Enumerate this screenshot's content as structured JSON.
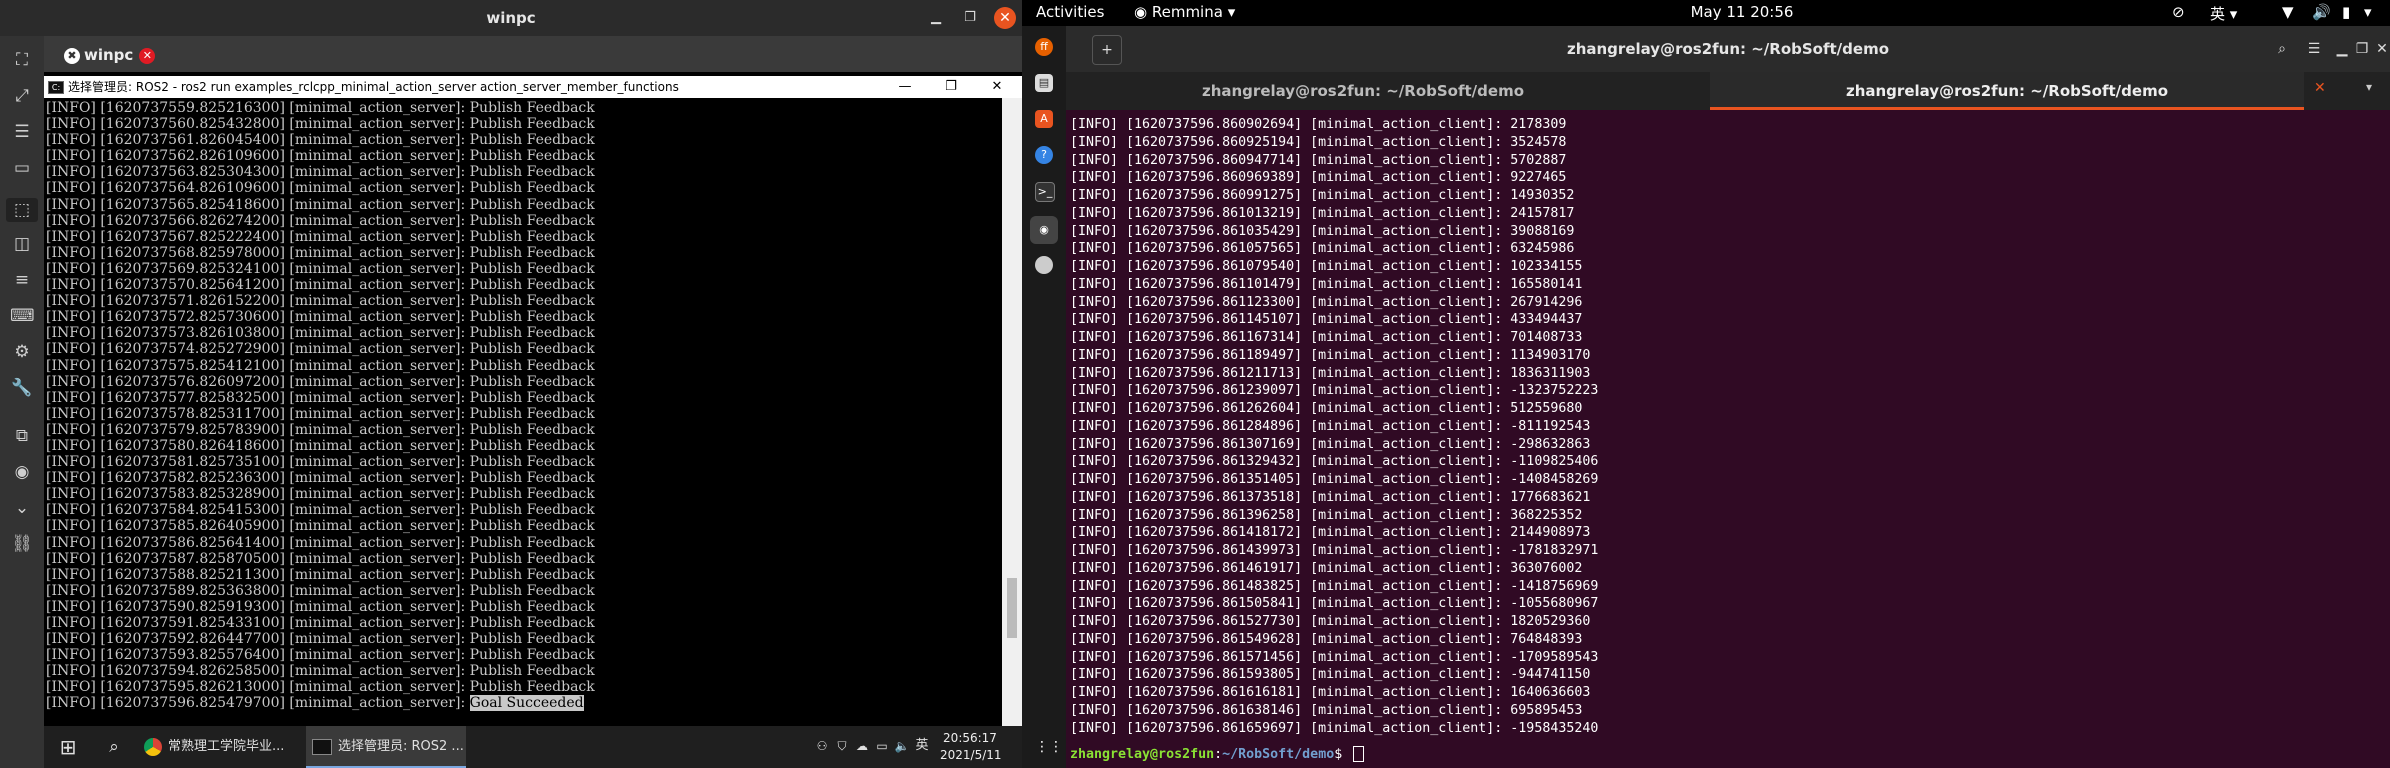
{
  "remmina": {
    "window_title": "winpc",
    "tab_label": "winpc",
    "sidebar_icons": [
      "fullscreen-icon",
      "scale-icon",
      "menu-icon",
      "window-icon",
      "selection-icon",
      "dynamic-resolution-icon",
      "list-icon",
      "keyboard-icon",
      "preferences-icon",
      "tools-icon",
      "duplicate-icon",
      "screenshot-icon",
      "chevron-down-icon",
      "disconnect-icon"
    ]
  },
  "cmd": {
    "title": "选择管理员: ROS2 - ros2  run examples_rclcpp_minimal_action_server action_server_member_functions",
    "lines": [
      "[INFO] [1620737559.825216300] [minimal_action_server]: Publish Feedback",
      "[INFO] [1620737560.825432800] [minimal_action_server]: Publish Feedback",
      "[INFO] [1620737561.826045400] [minimal_action_server]: Publish Feedback",
      "[INFO] [1620737562.826109600] [minimal_action_server]: Publish Feedback",
      "[INFO] [1620737563.825304300] [minimal_action_server]: Publish Feedback",
      "[INFO] [1620737564.826109600] [minimal_action_server]: Publish Feedback",
      "[INFO] [1620737565.825418600] [minimal_action_server]: Publish Feedback",
      "[INFO] [1620737566.826274200] [minimal_action_server]: Publish Feedback",
      "[INFO] [1620737567.825222400] [minimal_action_server]: Publish Feedback",
      "[INFO] [1620737568.825978000] [minimal_action_server]: Publish Feedback",
      "[INFO] [1620737569.825324100] [minimal_action_server]: Publish Feedback",
      "[INFO] [1620737570.825641200] [minimal_action_server]: Publish Feedback",
      "[INFO] [1620737571.826152200] [minimal_action_server]: Publish Feedback",
      "[INFO] [1620737572.825730600] [minimal_action_server]: Publish Feedback",
      "[INFO] [1620737573.826103800] [minimal_action_server]: Publish Feedback",
      "[INFO] [1620737574.825272900] [minimal_action_server]: Publish Feedback",
      "[INFO] [1620737575.825412100] [minimal_action_server]: Publish Feedback",
      "[INFO] [1620737576.826097200] [minimal_action_server]: Publish Feedback",
      "[INFO] [1620737577.825832500] [minimal_action_server]: Publish Feedback",
      "[INFO] [1620737578.825311700] [minimal_action_server]: Publish Feedback",
      "[INFO] [1620737579.825783900] [minimal_action_server]: Publish Feedback",
      "[INFO] [1620737580.826418600] [minimal_action_server]: Publish Feedback",
      "[INFO] [1620737581.825735100] [minimal_action_server]: Publish Feedback",
      "[INFO] [1620737582.825236300] [minimal_action_server]: Publish Feedback",
      "[INFO] [1620737583.825328900] [minimal_action_server]: Publish Feedback",
      "[INFO] [1620737584.825415300] [minimal_action_server]: Publish Feedback",
      "[INFO] [1620737585.826405900] [minimal_action_server]: Publish Feedback",
      "[INFO] [1620737586.825641400] [minimal_action_server]: Publish Feedback",
      "[INFO] [1620737587.825870500] [minimal_action_server]: Publish Feedback",
      "[INFO] [1620737588.825211300] [minimal_action_server]: Publish Feedback",
      "[INFO] [1620737589.825363800] [minimal_action_server]: Publish Feedback",
      "[INFO] [1620737590.825919300] [minimal_action_server]: Publish Feedback",
      "[INFO] [1620737591.825433100] [minimal_action_server]: Publish Feedback",
      "[INFO] [1620737592.826447700] [minimal_action_server]: Publish Feedback",
      "[INFO] [1620737593.825576400] [minimal_action_server]: Publish Feedback",
      "[INFO] [1620737594.826258500] [minimal_action_server]: Publish Feedback",
      "[INFO] [1620737595.826213000] [minimal_action_server]: Publish Feedback"
    ],
    "last_line_prefix": "[INFO] [1620737596.825479700] [minimal_action_server]: ",
    "last_line_highlight": "Goal Succeeded"
  },
  "taskbar": {
    "chrome_label": "常熟理工学院毕业...",
    "cmd_label": "选择管理员: ROS2 ...",
    "ime": "英",
    "time": "20:56:17",
    "date": "2021/5/11"
  },
  "ubuntu": {
    "activities": "Activities",
    "app_menu": "Remmina",
    "clock": "May 11  20:56",
    "input_method": "英"
  },
  "terminal": {
    "title": "zhangrelay@ros2fun: ~/RobSoft/demo",
    "tabs": [
      "zhangrelay@ros2fun: ~/RobSoft/demo",
      "zhangrelay@ros2fun: ~/RobSoft/demo"
    ],
    "lines": [
      "[INFO] [1620737596.860902694] [minimal_action_client]: 2178309",
      "[INFO] [1620737596.860925194] [minimal_action_client]: 3524578",
      "[INFO] [1620737596.860947714] [minimal_action_client]: 5702887",
      "[INFO] [1620737596.860969389] [minimal_action_client]: 9227465",
      "[INFO] [1620737596.860991275] [minimal_action_client]: 14930352",
      "[INFO] [1620737596.861013219] [minimal_action_client]: 24157817",
      "[INFO] [1620737596.861035429] [minimal_action_client]: 39088169",
      "[INFO] [1620737596.861057565] [minimal_action_client]: 63245986",
      "[INFO] [1620737596.861079540] [minimal_action_client]: 102334155",
      "[INFO] [1620737596.861101479] [minimal_action_client]: 165580141",
      "[INFO] [1620737596.861123300] [minimal_action_client]: 267914296",
      "[INFO] [1620737596.861145107] [minimal_action_client]: 433494437",
      "[INFO] [1620737596.861167314] [minimal_action_client]: 701408733",
      "[INFO] [1620737596.861189497] [minimal_action_client]: 1134903170",
      "[INFO] [1620737596.861211713] [minimal_action_client]: 1836311903",
      "[INFO] [1620737596.861239097] [minimal_action_client]: -1323752223",
      "[INFO] [1620737596.861262604] [minimal_action_client]: 512559680",
      "[INFO] [1620737596.861284896] [minimal_action_client]: -811192543",
      "[INFO] [1620737596.861307169] [minimal_action_client]: -298632863",
      "[INFO] [1620737596.861329432] [minimal_action_client]: -1109825406",
      "[INFO] [1620737596.861351405] [minimal_action_client]: -1408458269",
      "[INFO] [1620737596.861373518] [minimal_action_client]: 1776683621",
      "[INFO] [1620737596.861396258] [minimal_action_client]: 368225352",
      "[INFO] [1620737596.861418172] [minimal_action_client]: 2144908973",
      "[INFO] [1620737596.861439973] [minimal_action_client]: -1781832971",
      "[INFO] [1620737596.861461917] [minimal_action_client]: 363076002",
      "[INFO] [1620737596.861483825] [minimal_action_client]: -1418756969",
      "[INFO] [1620737596.861505841] [minimal_action_client]: -1055680967",
      "[INFO] [1620737596.861527730] [minimal_action_client]: 1820529360",
      "[INFO] [1620737596.861549628] [minimal_action_client]: 764848393",
      "[INFO] [1620737596.861571456] [minimal_action_client]: -1709589543",
      "[INFO] [1620737596.861593805] [minimal_action_client]: -944741150",
      "[INFO] [1620737596.861616181] [minimal_action_client]: 1640636603",
      "[INFO] [1620737596.861638146] [minimal_action_client]: 695895453",
      "[INFO] [1620737596.861659697] [minimal_action_client]: -1958435240"
    ],
    "prompt_user": "zhangrelay@ros2fun",
    "prompt_sep": ":",
    "prompt_path": "~/RobSoft/demo",
    "prompt_dollar": "$ "
  }
}
